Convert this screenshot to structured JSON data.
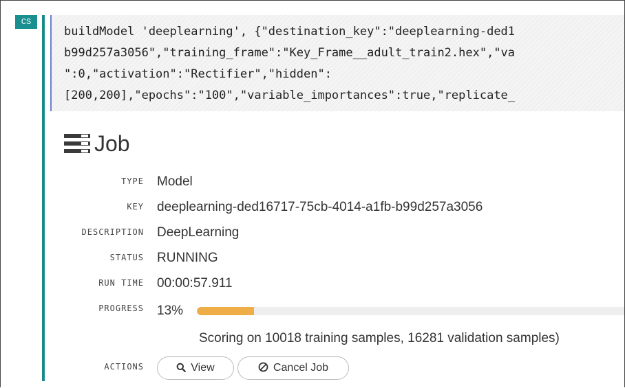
{
  "cell": {
    "badge": "CS",
    "code_lines": [
      "buildModel 'deeplearning', {\"destination_key\":\"deeplearning-ded1",
      "b99d257a3056\",\"training_frame\":\"Key_Frame__adult_train2.hex\",\"va",
      "\":0,\"activation\":\"Rectifier\",\"hidden\":",
      "[200,200],\"epochs\":\"100\",\"variable_importances\":true,\"replicate_"
    ]
  },
  "job": {
    "title": "Job",
    "icon": "server-stack-icon",
    "fields": {
      "type_label": "TYPE",
      "type_value": "Model",
      "key_label": "KEY",
      "key_value": "deeplearning-ded16717-75cb-4014-a1fb-b99d257a3056",
      "description_label": "DESCRIPTION",
      "description_value": "DeepLearning",
      "status_label": "STATUS",
      "status_value": "RUNNING",
      "runtime_label": "RUN TIME",
      "runtime_value": "00:00:57.911",
      "progress_label": "PROGRESS",
      "progress_value": "13%",
      "progress_fraction": 0.13,
      "progress_message": "Scoring on 10018 training samples, 16281 validation samples)",
      "actions_label": "ACTIONS"
    },
    "actions": {
      "view_label": "View",
      "view_icon": "search-icon",
      "cancel_label": "Cancel Job",
      "cancel_icon": "cancel-icon"
    }
  },
  "colors": {
    "accent": "#178b8b",
    "code_border": "#6b82c6",
    "progress": "#efad48"
  }
}
